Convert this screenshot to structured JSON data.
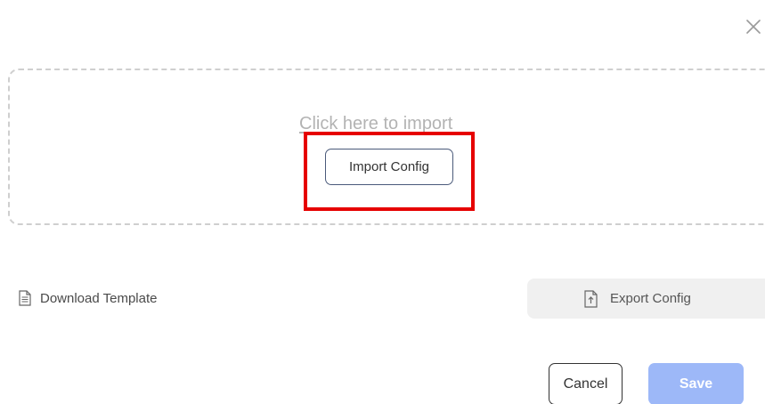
{
  "dialog": {
    "close_icon": "close-icon"
  },
  "dropzone": {
    "hint": "Click here to import",
    "import_button_label": "Import Config"
  },
  "actions": {
    "download_template_label": "Download Template",
    "download_icon": "document-icon",
    "export_config_label": "Export Config",
    "export_icon": "file-upload-icon"
  },
  "footer": {
    "cancel_label": "Cancel",
    "save_label": "Save"
  },
  "colors": {
    "highlight": "#e60000",
    "save_button": "#9db8f8",
    "export_button_bg": "#f0f0f0",
    "dropzone_border": "#cfcfcf"
  }
}
